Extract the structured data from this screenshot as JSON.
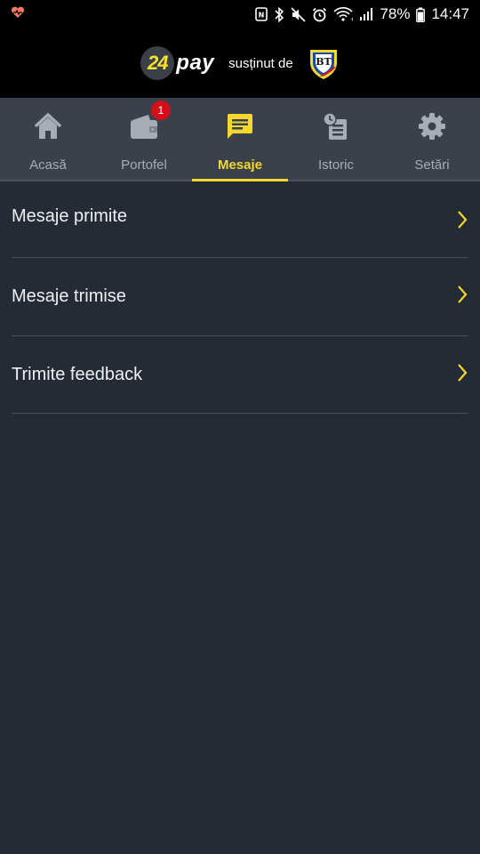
{
  "status_bar": {
    "battery_percent": "78%",
    "time": "14:47"
  },
  "header": {
    "logo_number": "24",
    "logo_word": "pay",
    "supported_by": "susținut de",
    "partner_logo_text": "BT"
  },
  "tabs": [
    {
      "label": "Acasă",
      "icon": "home-icon",
      "active": false
    },
    {
      "label": "Portofel",
      "icon": "wallet-icon",
      "active": false,
      "badge": "1"
    },
    {
      "label": "Mesaje",
      "icon": "message-icon",
      "active": true
    },
    {
      "label": "Istoric",
      "icon": "history-icon",
      "active": false
    },
    {
      "label": "Setări",
      "icon": "gear-icon",
      "active": false
    }
  ],
  "menu": [
    {
      "label": "Mesaje primite"
    },
    {
      "label": "Mesaje trimise"
    },
    {
      "label": "Trimite feedback"
    }
  ],
  "colors": {
    "background": "#252b35",
    "tabbar": "#3b414b",
    "accent": "#f3d830",
    "badge": "#d3101a"
  }
}
